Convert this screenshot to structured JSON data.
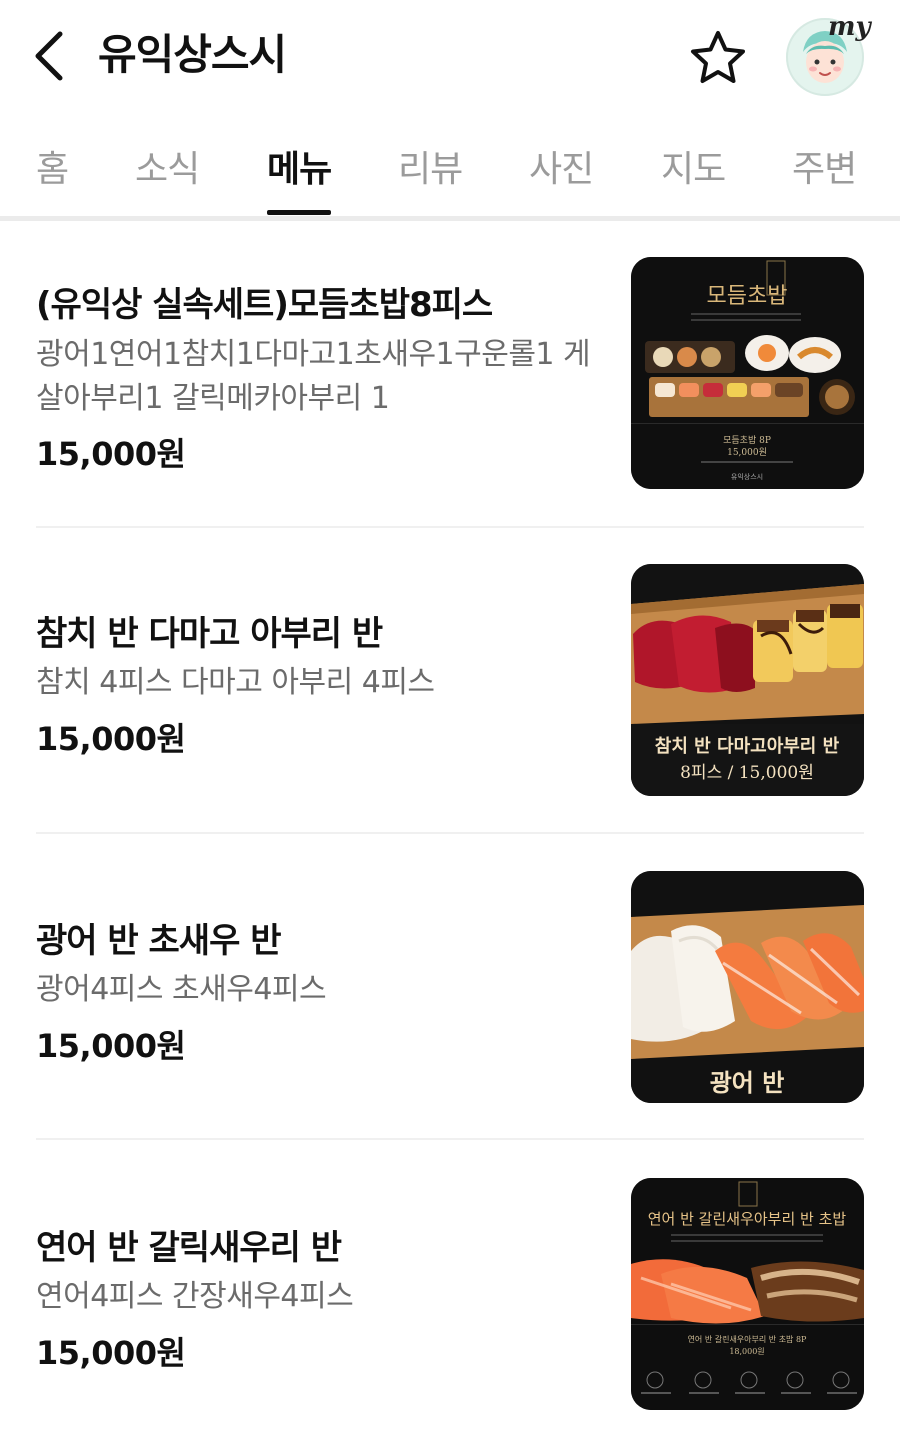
{
  "header": {
    "title": "유익상스시",
    "avatar_badge": "my"
  },
  "tabs": [
    {
      "label": "홈"
    },
    {
      "label": "소식"
    },
    {
      "label": "메뉴",
      "active": true
    },
    {
      "label": "리뷰"
    },
    {
      "label": "사진"
    },
    {
      "label": "지도"
    },
    {
      "label": "주변"
    }
  ],
  "menu": [
    {
      "name": "(유익상 실속세트)모듬초밥8피스",
      "description": "광어1연어1참치1다마고1초새우1구운롤1 게살아부리1 갈릭메카아부리 1",
      "price": "15,000원",
      "thumb": {
        "title": "모듬초밥",
        "label": "모듬초밥 8P",
        "price": "15,000원",
        "shop": "유익상스시"
      }
    },
    {
      "name": "참치 반 다마고 아부리 반",
      "description": "참치 4피스 다마고 아부리 4피스",
      "price": "15,000원",
      "thumb": {
        "line1": "참치 반 다마고아부리 반",
        "line2": "8피스 / 15,000원"
      }
    },
    {
      "name": "광어 반 초새우 반",
      "description": "광어4피스 초새우4피스",
      "price": "15,000원",
      "thumb": {
        "line1": "광어 반"
      }
    },
    {
      "name": "연어 반 갈릭새우리 반",
      "description": "연어4피스 간장새우4피스",
      "price": "15,000원",
      "thumb": {
        "title": "연어 반 갈린새우아부리 반 초밥",
        "label": "연어 반 갈린새우아부리 반 초밥 8P",
        "price": "18,000원"
      }
    }
  ],
  "colors": {
    "active_tab": "#111111",
    "inactive_tab": "#9b9b9b",
    "description": "#6b6b6b",
    "gold": "#d9b77a"
  }
}
